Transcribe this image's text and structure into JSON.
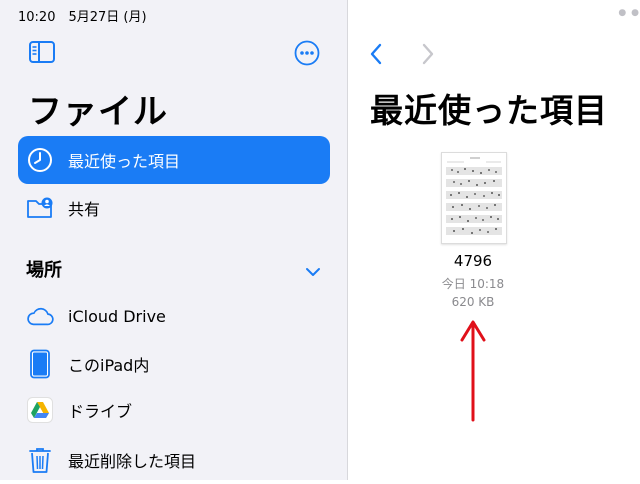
{
  "status": {
    "time_date": "10:20　5月27日 (月)"
  },
  "sidebar": {
    "title": "ファイル",
    "items": [
      {
        "label": "最近使った項目",
        "icon": "clock-icon",
        "selected": true
      },
      {
        "label": "共有",
        "icon": "shared-folder-icon",
        "selected": false
      }
    ],
    "section_title": "場所",
    "locations": [
      {
        "label": "iCloud Drive",
        "icon": "cloud-icon"
      },
      {
        "label": "このiPad内",
        "icon": "ipad-icon"
      },
      {
        "label": "ドライブ",
        "icon": "google-drive-icon"
      },
      {
        "label": "最近削除した項目",
        "icon": "trash-icon"
      }
    ]
  },
  "main": {
    "title": "最近使った項目",
    "file": {
      "name": "4796",
      "date": "今日 10:18",
      "size": "620 KB"
    }
  },
  "colors": {
    "accent": "#1a7cf5",
    "arrow": "#e0101a",
    "secondary_text": "#8a8a8e"
  }
}
